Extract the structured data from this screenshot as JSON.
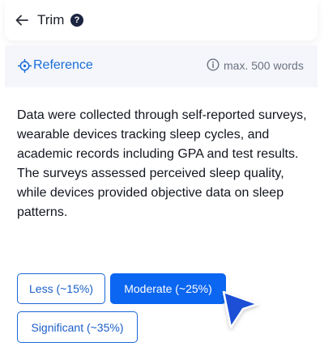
{
  "header": {
    "back_icon": "arrow-left-icon",
    "title": "Trim",
    "help_icon": "question-circle-icon",
    "help_glyph": "?"
  },
  "reference": {
    "icon": "target-icon",
    "label": "Reference",
    "info_icon": "info-circle-icon",
    "word_limit": "max. 500 words"
  },
  "content": {
    "paragraph": "Data were collected through self-reported surveys, wearable devices tracking sleep cycles, and academic records including GPA and test results. The surveys assessed perceived sleep quality, while devices provided objective data on sleep patterns."
  },
  "trim_options": {
    "less_label": "Less (~15%)",
    "moderate_label": "Moderate (~25%)",
    "significant_label": "Significant (~35%)",
    "selected": "Moderate (~25%)"
  },
  "colors": {
    "accent": "#0b66f1",
    "link": "#1a6ed8",
    "text": "#12161f",
    "muted": "#6b7280",
    "reference_bg": "#f4f6fb",
    "cursor": "#1a4fd6"
  }
}
